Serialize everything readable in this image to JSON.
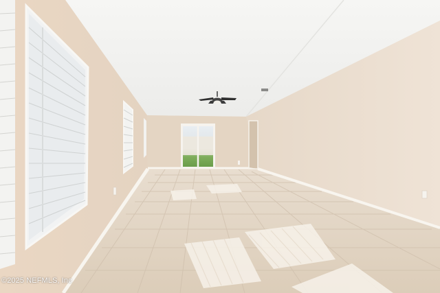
{
  "watermark": "©2025 NEFMLS, Inc",
  "colors": {
    "ceiling": "#f4f4f2",
    "wall_left": "#e6d5c3",
    "wall_right": "#ece0d2",
    "wall_back": "#e3d4c2",
    "floor": "#e2d5c4",
    "baseboard": "#faf7f2",
    "blind": "#f7f7f5"
  }
}
